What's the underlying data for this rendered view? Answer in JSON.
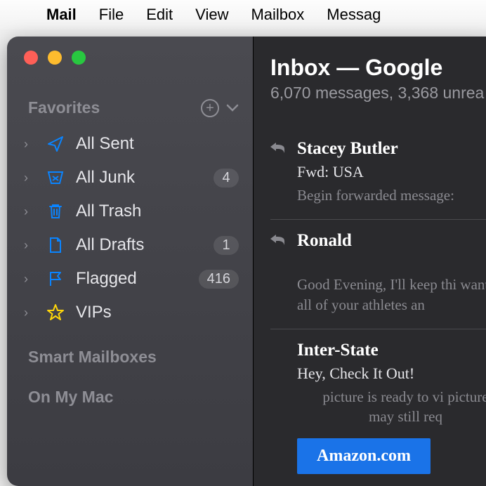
{
  "menubar": {
    "app": "Mail",
    "items": [
      "File",
      "Edit",
      "View",
      "Mailbox",
      "Messag"
    ]
  },
  "sidebar": {
    "favorites_label": "Favorites",
    "smart_label": "Smart Mailboxes",
    "onmymac_label": "On My Mac",
    "items": [
      {
        "label": "All Sent",
        "badge": "",
        "icon": "send"
      },
      {
        "label": "All Junk",
        "badge": "4",
        "icon": "junk"
      },
      {
        "label": "All Trash",
        "badge": "",
        "icon": "trash"
      },
      {
        "label": "All Drafts",
        "badge": "1",
        "icon": "draft"
      },
      {
        "label": "Flagged",
        "badge": "416",
        "icon": "flag"
      },
      {
        "label": "VIPs",
        "badge": "",
        "icon": "star"
      }
    ]
  },
  "content": {
    "title": "Inbox — Google",
    "subtitle": "6,070 messages, 3,368 unrea",
    "messages": [
      {
        "sender": "Stacey Butler",
        "subject": "Fwd: USA",
        "preview": "Begin forwarded message:",
        "has_reply": true
      },
      {
        "sender": "Ronald",
        "subject": "",
        "preview": "Good Evening, I'll keep thi want all of your athletes an",
        "has_reply": true
      },
      {
        "sender": "Inter-State",
        "subject": "Hey, Check It Out!",
        "preview": "picture is ready to vi picture may still req",
        "has_reply": false,
        "cta": "Amazon.com"
      }
    ]
  }
}
